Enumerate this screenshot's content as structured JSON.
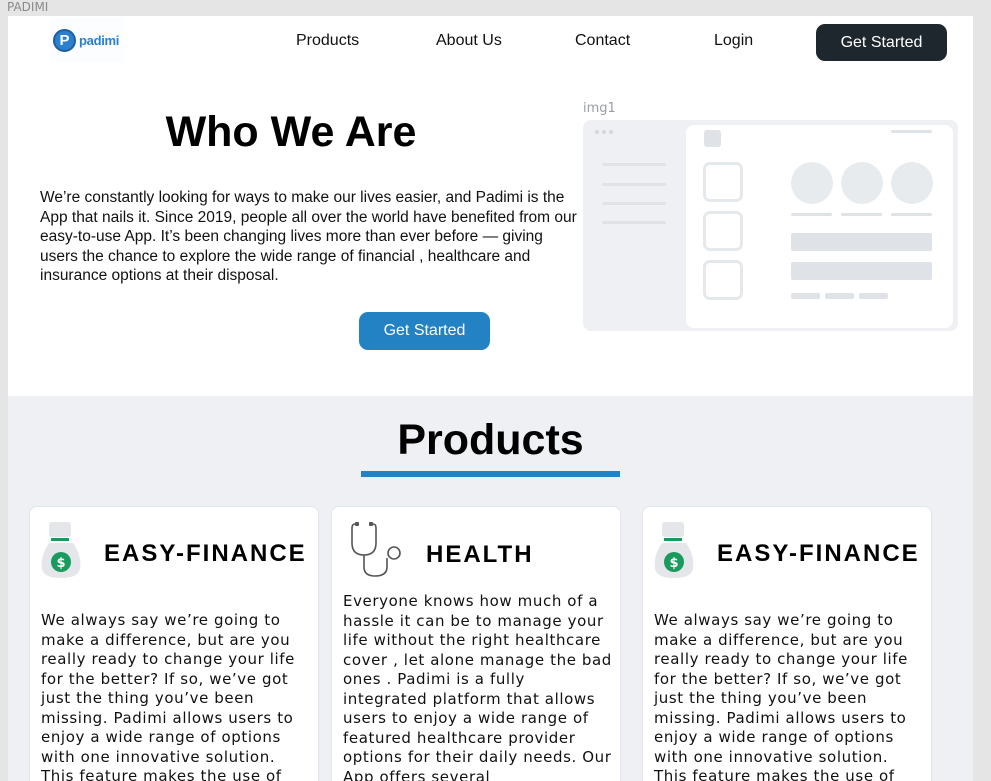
{
  "frame": {
    "label": "PADIMI"
  },
  "nav": {
    "logo_text": "padimi",
    "logo_letter": "P",
    "links": [
      "Products",
      "About Us",
      "Contact",
      "Login"
    ],
    "cta": "Get Started"
  },
  "hero": {
    "title": "Who We Are",
    "body": "We’re constantly looking for ways to make our lives easier, and Padimi is the App that nails it. Since 2019, people all over the world have benefited from our easy-to-use App. It’s been changing lives more than ever before — giving users the chance to explore the wide range of financial , healthcare and insurance  options at their disposal.",
    "cta": "Get Started",
    "image_label": "img1"
  },
  "products": {
    "title": "Products",
    "cards": [
      {
        "title": "EASY-FINANCE",
        "icon": "money-bag-icon",
        "body": "We always say we’re going to make a difference, but are you really ready to change your life for the better? If so, we’ve got just the thing you’ve been missing. Padimi allows users to enjoy a wide range of options with one innovative solution. This feature makes the use of"
      },
      {
        "title": "HEALTH",
        "icon": "stethoscope-icon",
        "body": "Everyone knows how much of a hassle it can be to manage your life without the right healthcare cover , let alone manage the bad ones . Padimi is a fully integrated platform that allows users to enjoy a wide range of featured healthcare provider  options for their daily needs. Our App offers several"
      },
      {
        "title": "EASY-FINANCE",
        "icon": "money-bag-icon",
        "body": "We always say we’re going to make a difference, but are you really ready to change your life for the better? If so, we’ve got just the thing you’ve been missing. Padimi allows users to enjoy a wide range of options with one innovative solution. This feature makes the use of"
      }
    ]
  },
  "colors": {
    "primary_blue": "#2282c4",
    "dark_button": "#1f272e",
    "section_bg": "#eef0f4",
    "money_green": "#1a9a5c"
  }
}
